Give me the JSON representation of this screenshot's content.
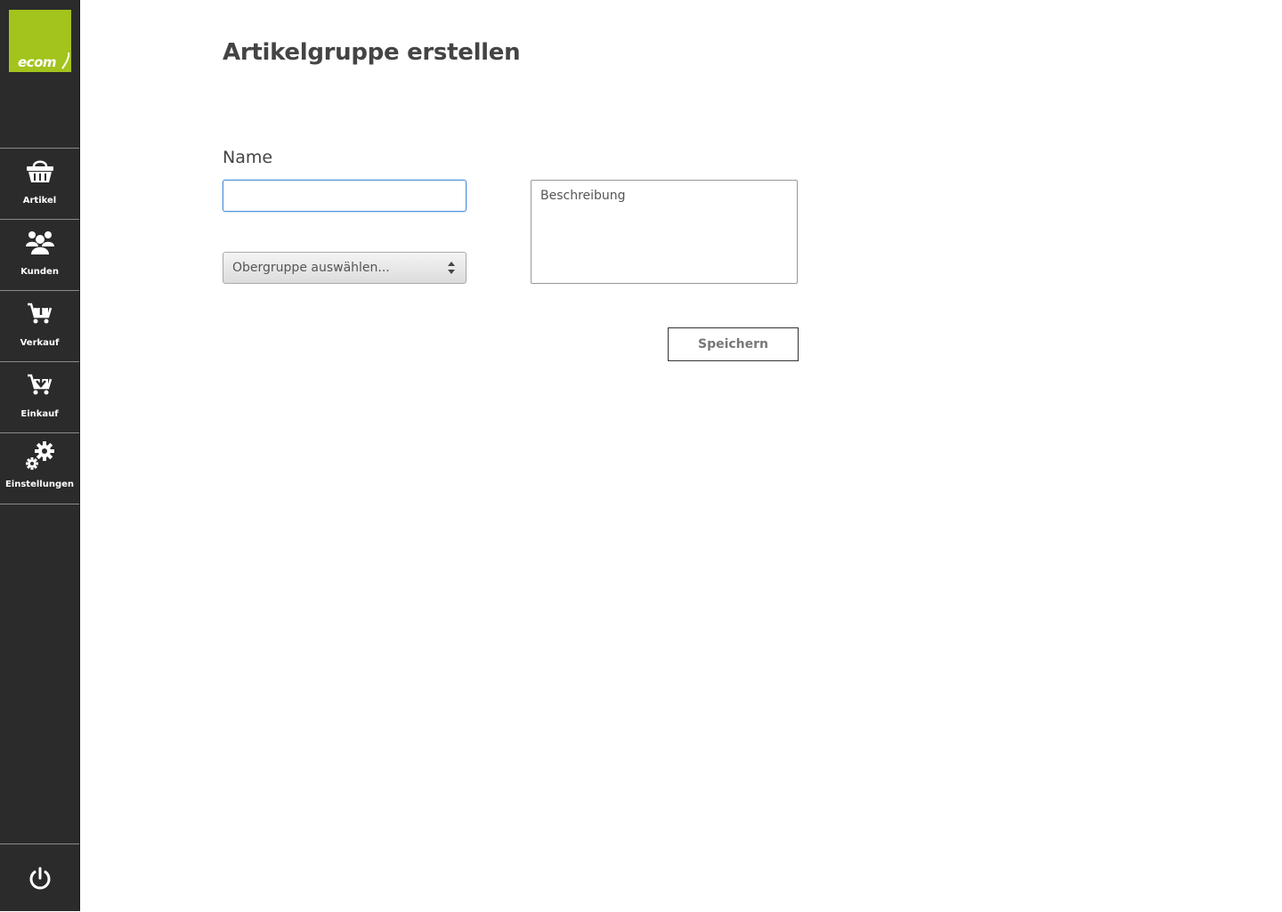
{
  "brand": {
    "logo_text": "ecom",
    "accent_color": "#a3c31d",
    "sidebar_color": "#2b2b2b"
  },
  "sidebar": {
    "items": [
      {
        "label": "Artikel",
        "icon": "basket-icon"
      },
      {
        "label": "Kunden",
        "icon": "users-icon"
      },
      {
        "label": "Verkauf",
        "icon": "cart-upload-icon"
      },
      {
        "label": "Einkauf",
        "icon": "cart-download-icon"
      },
      {
        "label": "Einstellungen",
        "icon": "gears-icon"
      }
    ],
    "logout_icon": "power-icon"
  },
  "page": {
    "title": "Artikelgruppe erstellen"
  },
  "form": {
    "name_label": "Name",
    "name_value": "",
    "parent_select_value": "Obergruppe auswählen...",
    "description_placeholder": "Beschreibung",
    "save_label": "Speichern",
    "focus_color": "#4a90d9"
  }
}
